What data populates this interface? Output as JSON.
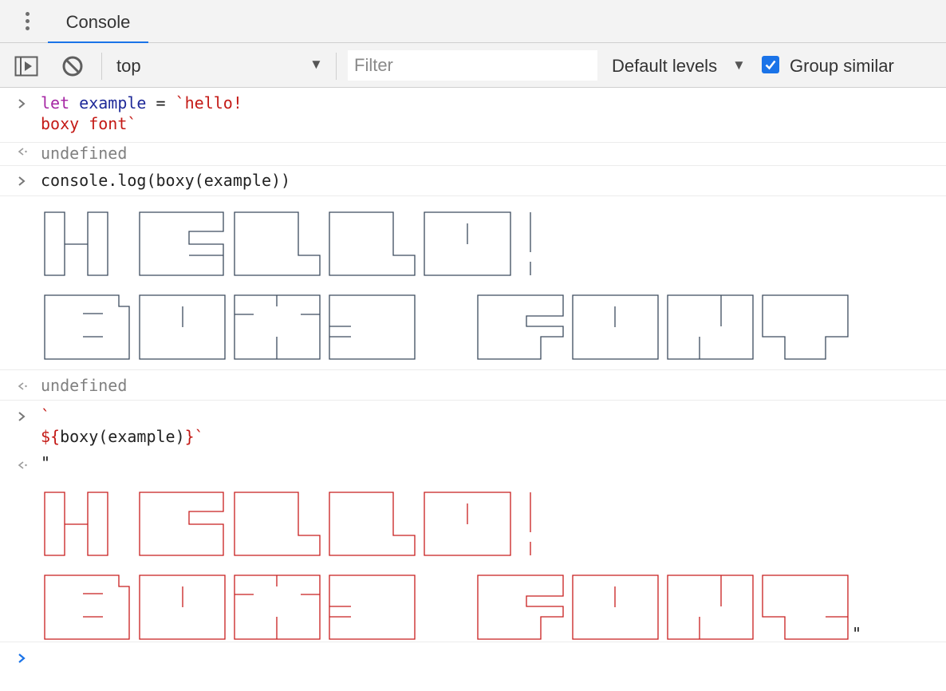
{
  "tab": {
    "label": "Console"
  },
  "toolbar": {
    "context": "top",
    "filter_placeholder": "Filter",
    "levels": "Default levels",
    "group_similar": "Group similar",
    "group_similar_checked": true
  },
  "entries": [
    {
      "type": "input",
      "lines": [
        [
          [
            "let",
            "kw"
          ],
          [
            " ",
            "plain"
          ],
          [
            "example",
            "var"
          ],
          [
            " = ",
            "plain"
          ],
          [
            "`hello!",
            "str"
          ]
        ],
        [
          [
            "boxy font`",
            "str"
          ]
        ]
      ]
    },
    {
      "type": "result",
      "text": "undefined"
    },
    {
      "type": "input",
      "lines": [
        [
          [
            "console.log(boxy(example))",
            "plain"
          ]
        ]
      ]
    },
    {
      "type": "log-art",
      "line1": "HELLO!",
      "line2": "BOXY FONT",
      "color": "#3c4b5e"
    },
    {
      "type": "result",
      "text": "undefined"
    },
    {
      "type": "input",
      "lines": [
        [
          [
            "`",
            "str"
          ]
        ],
        [
          [
            "${",
            "str"
          ],
          [
            "boxy(example)",
            "plain"
          ],
          [
            "}`",
            "str"
          ]
        ]
      ]
    },
    {
      "type": "result-art",
      "open_quote": "\"",
      "close_quote": "\"",
      "line1": "HELLO!",
      "line2": "BOXY FONT",
      "color": "#c81e1e"
    },
    {
      "type": "prompt"
    }
  ],
  "colors": {
    "accent": "#1a73e8",
    "string": "#c41a16",
    "keyword": "#a626a4",
    "variable": "#1f2a99",
    "log_art": "#3c4b5e",
    "result_art": "#c81e1e"
  },
  "icons": [
    "sidebar-toggle-icon",
    "clear-console-icon",
    "dropdown-arrow-icon",
    "checkbox-checked-icon",
    "input-prompt-icon",
    "result-arrow-icon"
  ]
}
